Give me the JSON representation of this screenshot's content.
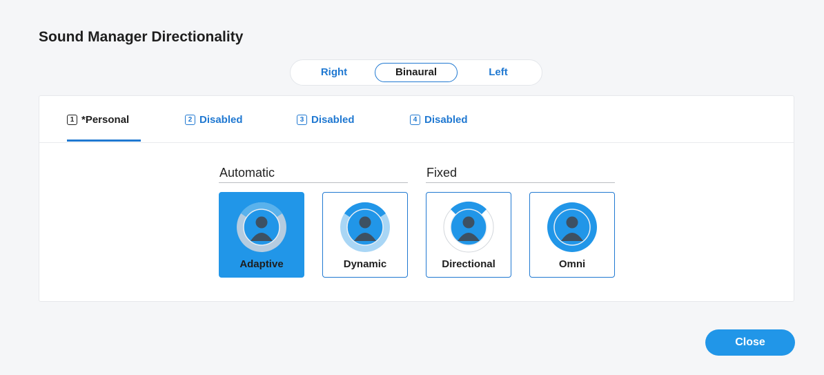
{
  "dialog": {
    "title": "Sound Manager Directionality"
  },
  "side_selector": {
    "options": [
      "Right",
      "Binaural",
      "Left"
    ],
    "selected": "Binaural"
  },
  "program_tabs": [
    {
      "number": "1",
      "label": "*Personal",
      "active": true
    },
    {
      "number": "2",
      "label": "Disabled",
      "active": false
    },
    {
      "number": "3",
      "label": "Disabled",
      "active": false
    },
    {
      "number": "4",
      "label": "Disabled",
      "active": false
    }
  ],
  "groups": {
    "automatic": "Automatic",
    "fixed": "Fixed"
  },
  "modes": [
    {
      "label": "Adaptive",
      "icon": "adaptive-mic-icon",
      "selected": true
    },
    {
      "label": "Dynamic",
      "icon": "dynamic-mic-icon",
      "selected": false
    },
    {
      "label": "Directional",
      "icon": "directional-mic-icon",
      "selected": false
    },
    {
      "label": "Omni",
      "icon": "omni-mic-icon",
      "selected": false
    }
  ],
  "footer": {
    "close_label": "Close"
  },
  "colors": {
    "accent": "#1f78d1",
    "selected_fill": "#2196e8",
    "person": "#3d5163"
  }
}
